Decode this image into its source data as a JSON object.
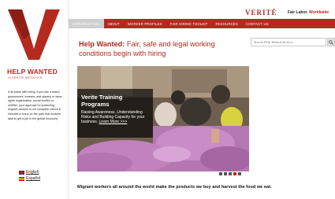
{
  "sidebar": {
    "title": "HELP WANTED",
    "subtitle": "A VERITÉ INITIATIVE",
    "intro": "It all starts with hiring. If you are a brand, government, investor, anti-slavery or labor-rights organization, social auditor or certifier, your approach to protecting migrant workers is not complete unless it includes a focus on the path that workers take to get a job in the global economy.",
    "languages": [
      {
        "label": "English",
        "flag": "uk-flag"
      },
      {
        "label": "Español",
        "flag": "spain-flag"
      }
    ]
  },
  "header": {
    "brand": "VERITÉ",
    "tagline": "Fair Labor.",
    "tagline_accent": "Worldwide"
  },
  "nav": {
    "items": [
      {
        "label": "INTRODUCTION",
        "active": true
      },
      {
        "label": "ABOUT",
        "active": false
      },
      {
        "label": "WORKER PROFILES",
        "active": false
      },
      {
        "label": "FAIR HIRING TOOLKIT",
        "active": false
      },
      {
        "label": "RESOURCES",
        "active": false
      },
      {
        "label": "CONTACT US",
        "active": false
      }
    ]
  },
  "main": {
    "headline_bold": "Help Wanted:",
    "headline_rest": " Fair, safe and legal working conditions begin with hiring",
    "search_placeholder": "Search Help Wanted Section...",
    "hero": {
      "title": "Verite Training Programs",
      "body": "Raising Awareness, Understanding Risks and Building Capacity for your business.",
      "link": "Learn More >>>"
    },
    "slides": {
      "count": 5,
      "active": 4
    },
    "bottom_text": "Migrant workers all around the world make the products we buy and harvest the food we eat."
  },
  "colors": {
    "brand": "#b52a1f",
    "nav_active": "#cfcfcf"
  }
}
